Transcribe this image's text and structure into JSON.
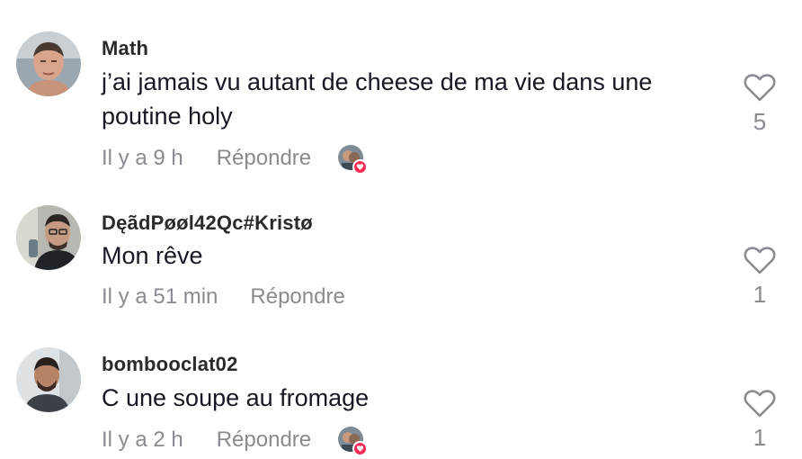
{
  "comments": [
    {
      "username": "Math",
      "text": "j’ai jamais vu autant de cheese de ma vie dans une poutine holy",
      "time": "Il y a 9 h",
      "reply_label": "Répondre",
      "likes": "5",
      "creator_liked": true
    },
    {
      "username": "DęãdPøøl42Qc#Kristø",
      "text": "Mon rêve",
      "time": "Il y a 51 min",
      "reply_label": "Répondre",
      "likes": "1",
      "creator_liked": false
    },
    {
      "username": "bombooclat02",
      "text": "C une soupe au fromage",
      "time": "Il y a 2 h",
      "reply_label": "Répondre",
      "likes": "1",
      "creator_liked": true
    }
  ],
  "icons": {
    "like": "heart-outline-icon",
    "creator_like_badge": "heart-icon"
  },
  "colors": {
    "text": "#161823",
    "secondary": "#8a8b91",
    "accent": "#fe2c55"
  }
}
